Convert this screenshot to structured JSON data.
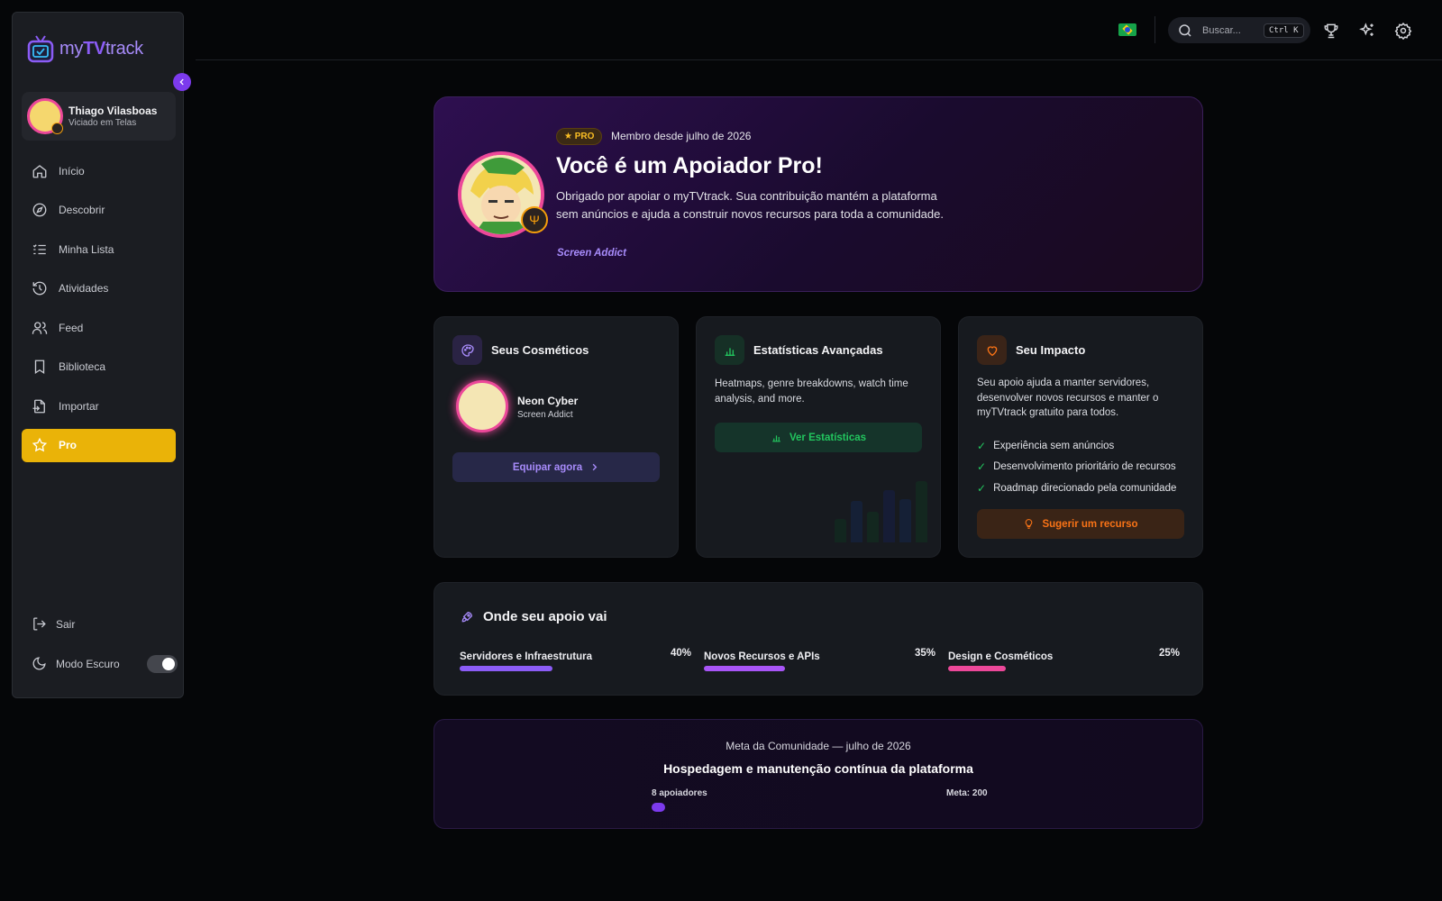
{
  "app": {
    "logo_prefix": "my",
    "logo_bold": "TV",
    "logo_suffix": "track"
  },
  "user": {
    "name": "Thiago Vilasboas",
    "subtitle": "Viciado em Telas"
  },
  "nav": [
    {
      "label": "Início",
      "icon": "home-icon"
    },
    {
      "label": "Descobrir",
      "icon": "compass-icon"
    },
    {
      "label": "Minha Lista",
      "icon": "list-icon"
    },
    {
      "label": "Atividades",
      "icon": "history-icon"
    },
    {
      "label": "Feed",
      "icon": "users-icon"
    },
    {
      "label": "Biblioteca",
      "icon": "bookmark-icon"
    },
    {
      "label": "Importar",
      "icon": "import-icon"
    },
    {
      "label": "Pro",
      "icon": "star-icon",
      "active": true
    }
  ],
  "sidebar_bottom": {
    "logout_label": "Sair",
    "dark_mode_label": "Modo Escuro",
    "dark_mode_on": true
  },
  "topbar": {
    "search_placeholder": "Buscar...",
    "shortcut": "Ctrl K"
  },
  "hero": {
    "badge": "★ PRO",
    "member_since": "Membro desde julho de 2026",
    "title": "Você é um Apoiador Pro!",
    "description": "Obrigado por apoiar o myTVtrack. Sua contribuição mantém a plataforma sem anúncios e ajuda a construir novos recursos para toda a comunidade.",
    "tag": "Screen Addict"
  },
  "cosmetics": {
    "title": "Seus Cosméticos",
    "item_name": "Neon Cyber",
    "item_sub": "Screen Addict",
    "button": "Equipar agora"
  },
  "stats": {
    "title": "Estatísticas Avançadas",
    "text": "Heatmaps, genre breakdowns, watch time analysis, and more.",
    "button": "Ver Estatísticas"
  },
  "impact": {
    "title": "Seu Impacto",
    "text": "Seu apoio ajuda a manter servidores, desenvolver novos recursos e manter o myTVtrack gratuito para todos.",
    "items": [
      "Experiência sem anúncios",
      "Desenvolvimento prioritário de recursos",
      "Roadmap direcionado pela comunidade"
    ],
    "button": "Sugerir um recurso"
  },
  "allocation": {
    "title": "Onde seu apoio vai",
    "rows": [
      {
        "label": "Servidores e Infraestrutura",
        "pct": "40%",
        "value": 0.4,
        "color": "#8b5cf6"
      },
      {
        "label": "Novos Recursos e APIs",
        "pct": "35%",
        "value": 0.35,
        "color": "#a855f7"
      },
      {
        "label": "Design e Cosméticos",
        "pct": "25%",
        "value": 0.25,
        "color": "#ec4899"
      }
    ]
  },
  "goal": {
    "subtitle": "Meta da Comunidade — julho de 2026",
    "title": "Hospedagem e manutenção contínua da plataforma",
    "supporters": "8 apoiadores",
    "target": "Meta: 200",
    "progress": 0.04
  },
  "colors": {
    "accent": "#7c3aed",
    "active_nav": "#eab308",
    "pink": "#ec4899",
    "green": "#22c55e",
    "orange": "#f97316"
  }
}
